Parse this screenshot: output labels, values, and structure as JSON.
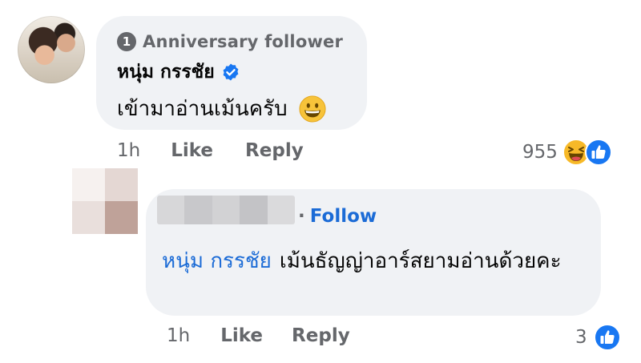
{
  "comment": {
    "badge_icon_text": "1",
    "badge_text": "Anniversary follower",
    "author": "หนุ่ม กรรชัย",
    "verified_icon": "verified-check-icon",
    "text": "เข้ามาอ่านเม้นครับ",
    "text_emoji": "grinning-face-icon",
    "actions": {
      "time": "1h",
      "like": "Like",
      "reply": "Reply"
    },
    "reactions": {
      "count": "955",
      "icons": [
        "haha-icon",
        "like-icon"
      ]
    }
  },
  "reply": {
    "author_name_blurred": true,
    "follow_separator": "·",
    "follow_label": "Follow",
    "mention": "หนุ่ม กรรชัย",
    "text": "เม้นธัญญ่าอาร์สยามอ่านด้วยคะ",
    "actions": {
      "time": "1h",
      "like": "Like",
      "reply": "Reply"
    },
    "reactions": {
      "count": "3",
      "icons": [
        "like-icon"
      ]
    }
  },
  "colors": {
    "bubble": "#f0f2f5",
    "secondary_text": "#65676b",
    "link_blue": "#1b6bd6",
    "like_blue": "#1877f2",
    "haha_yellow": "#f7b928"
  }
}
